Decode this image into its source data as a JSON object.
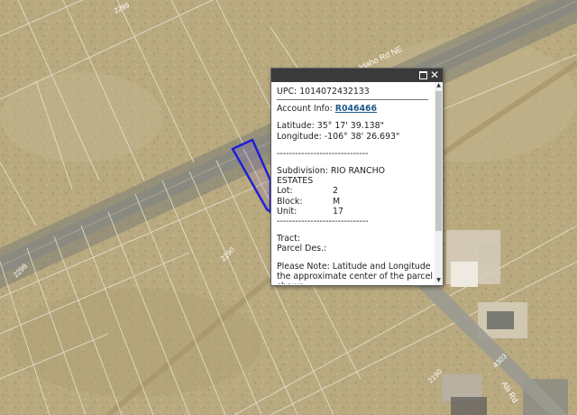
{
  "map": {
    "road_labels": {
      "idaho": "Idaho Rd NE",
      "alii": "Alii Rd"
    },
    "lot_numbers": {
      "n2299": "2299",
      "n2298": "2298",
      "n2290": "2290",
      "n2190": "2190",
      "n4303": "4303"
    },
    "colors": {
      "parcel_outline": "#1f1fd6",
      "parcel_line": "#e8e8d8",
      "road": "#8a8a80"
    }
  },
  "popup": {
    "upc": "UPC: 1014072432133",
    "account_label": "Account Info:",
    "account_value": "R046466",
    "latitude": "Latitude: 35° 17' 39.138\"",
    "longitude": "Longitude: -106° 38' 26.693\"",
    "dashes1": "------------------------------",
    "subdivision_1": "Subdivision: RIO RANCHO",
    "subdivision_2": "ESTATES",
    "lot_label": "Lot:",
    "lot_value": "2",
    "block_label": "Block:",
    "block_value": "M",
    "unit_label": "Unit:",
    "unit_value": "17",
    "dashes2": "------------------------------",
    "tract_label": "Tract:",
    "parcel_des_label": "Parcel Des.:",
    "note_1": "Please Note: Latitude and Longitude is",
    "note_2": "the approximate center of the parcel",
    "note_3": "shown"
  }
}
